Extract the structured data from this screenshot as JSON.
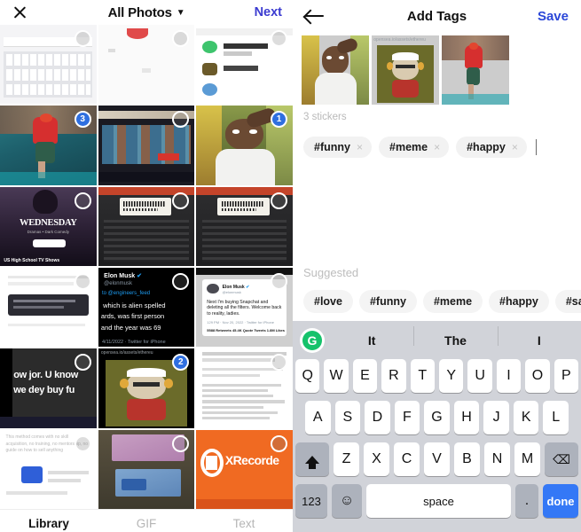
{
  "left_panel": {
    "close_icon": "close-icon",
    "title": "All Photos",
    "caret": "▼",
    "next_label": "Next",
    "tabs": [
      {
        "label": "Library",
        "active": true
      },
      {
        "label": "GIF",
        "active": false
      },
      {
        "label": "Text",
        "active": false
      }
    ],
    "grid": [
      {
        "name": "keyboard-stickers-screenshot",
        "badge": "",
        "selected": false,
        "kind": "keyboard-sticker"
      },
      {
        "name": "red-lips-screenshot",
        "badge": "",
        "selected": false,
        "kind": "light-photo"
      },
      {
        "name": "chat-list-screenshot",
        "badge": "",
        "selected": false,
        "kind": "chat-screenshot"
      },
      {
        "name": "dancer-red-shirt-photo",
        "badge": "3",
        "selected": true,
        "kind": "dancer"
      },
      {
        "name": "tv-shelf-store-photo",
        "badge": "",
        "selected": false,
        "kind": "tv-store"
      },
      {
        "name": "man-white-shirt-selfie",
        "badge": "1",
        "selected": true,
        "kind": "selfie"
      },
      {
        "name": "wednesday-netflix-poster",
        "badge": "",
        "selected": false,
        "kind": "wednesday"
      },
      {
        "name": "barcode-label-photo-1",
        "badge": "",
        "selected": false,
        "kind": "barcode"
      },
      {
        "name": "barcode-label-photo-2",
        "badge": "",
        "selected": false,
        "kind": "barcode"
      },
      {
        "name": "white-document-screenshot",
        "badge": "",
        "selected": false,
        "kind": "doc-white"
      },
      {
        "name": "elon-musk-tweet-dark",
        "badge": "",
        "selected": false,
        "kind": "tweet-dark"
      },
      {
        "name": "elon-musk-tweet-light",
        "badge": "",
        "selected": false,
        "kind": "tweet-light"
      },
      {
        "name": "pidgin-text-meme-dark",
        "badge": "",
        "selected": false,
        "kind": "meme-dark"
      },
      {
        "name": "bored-ape-nft-screenshot",
        "badge": "2",
        "selected": true,
        "kind": "ape"
      },
      {
        "name": "course-list-screenshot",
        "badge": "",
        "selected": false,
        "kind": "course-list"
      },
      {
        "name": "affiliate-text-screenshot",
        "badge": "",
        "selected": false,
        "kind": "affiliate"
      },
      {
        "name": "naira-banknotes-photo",
        "badge": "",
        "selected": false,
        "kind": "money"
      },
      {
        "name": "xrecorder-logo-screenshot",
        "badge": "",
        "selected": false,
        "kind": "xrecorder"
      }
    ],
    "meme_text_line1": "ow jor. U know",
    "meme_text_line2": "we dey buy fu",
    "wednesday_title": "WEDNESDAY",
    "wednesday_sub": "Dramas • Dark Comedy",
    "wednesday_footer": "US High School TV Shows",
    "xrecorder_label": "XRecorde",
    "tweet_name": "Elon Musk",
    "tweet_handle": "@elonmusk",
    "tweet_reply": "to @engineers_feed",
    "tweet_line1": "which is alien spelled",
    "tweet_line2": "ards, was first person",
    "tweet_line3": "and the year was 69",
    "tweet_date": "4/11/2022 · Twitter for iPhone",
    "tweet2_text": "Next I'm buying Snapchat and deleting all the filters. Welcome back to reality, ladies.",
    "tweet2_meta": "129 PM · Nov 20, 2022 · Twitter for iPhone",
    "tweet2_stats": "5588 Retweets  45.4K Quote Tweets  1.8M Likes",
    "ape_url": "opensea.io/assets/ethereu",
    "course_lines": "Here also you will be given an Expertnaire account for free",
    "affiliate_text": "This method comes with no skill acquisition, no training, no mentorship, no guide on how to sell anything"
  },
  "right_panel": {
    "back_icon": "back-arrow-icon",
    "title": "Add Tags",
    "save_label": "Save",
    "previews": [
      {
        "name": "preview-selfie",
        "kind": "selfie"
      },
      {
        "name": "preview-ape",
        "kind": "ape"
      },
      {
        "name": "preview-dancer",
        "kind": "dancer"
      }
    ],
    "stickers_count": "3 stickers",
    "tags": [
      {
        "label": "#funny",
        "remove": "×"
      },
      {
        "label": "#meme",
        "remove": "×"
      },
      {
        "label": "#happy",
        "remove": "×"
      }
    ],
    "suggested_label": "Suggested",
    "suggested": [
      "#love",
      "#funny",
      "#meme",
      "#happy",
      "#sad"
    ]
  },
  "keyboard": {
    "assistant_icon": "grammarly-icon",
    "assistant_glyph": "G",
    "suggestions": [
      "It",
      "The",
      "I"
    ],
    "row1": [
      "Q",
      "W",
      "E",
      "R",
      "T",
      "Y",
      "U",
      "I",
      "O",
      "P"
    ],
    "row2": [
      "A",
      "S",
      "D",
      "F",
      "G",
      "H",
      "J",
      "K",
      "L"
    ],
    "row3": [
      "Z",
      "X",
      "C",
      "V",
      "B",
      "N",
      "M"
    ],
    "shift_icon": "shift-icon",
    "backspace_icon": "backspace-icon",
    "backspace_glyph": "⌫",
    "numbers_label": "123",
    "emoji_label": "☺",
    "space_label": "space",
    "period_label": ".",
    "done_label": "done"
  },
  "colors": {
    "accent_blue": "#3478f6",
    "next_blue": "#3b3bd0",
    "save_blue": "#2b47d8",
    "badge_blue": "#2f6fe0",
    "keyboard_bg": "#d1d3d9",
    "chip_bg": "#f2f2f2",
    "grammarly_green": "#15c26b"
  }
}
